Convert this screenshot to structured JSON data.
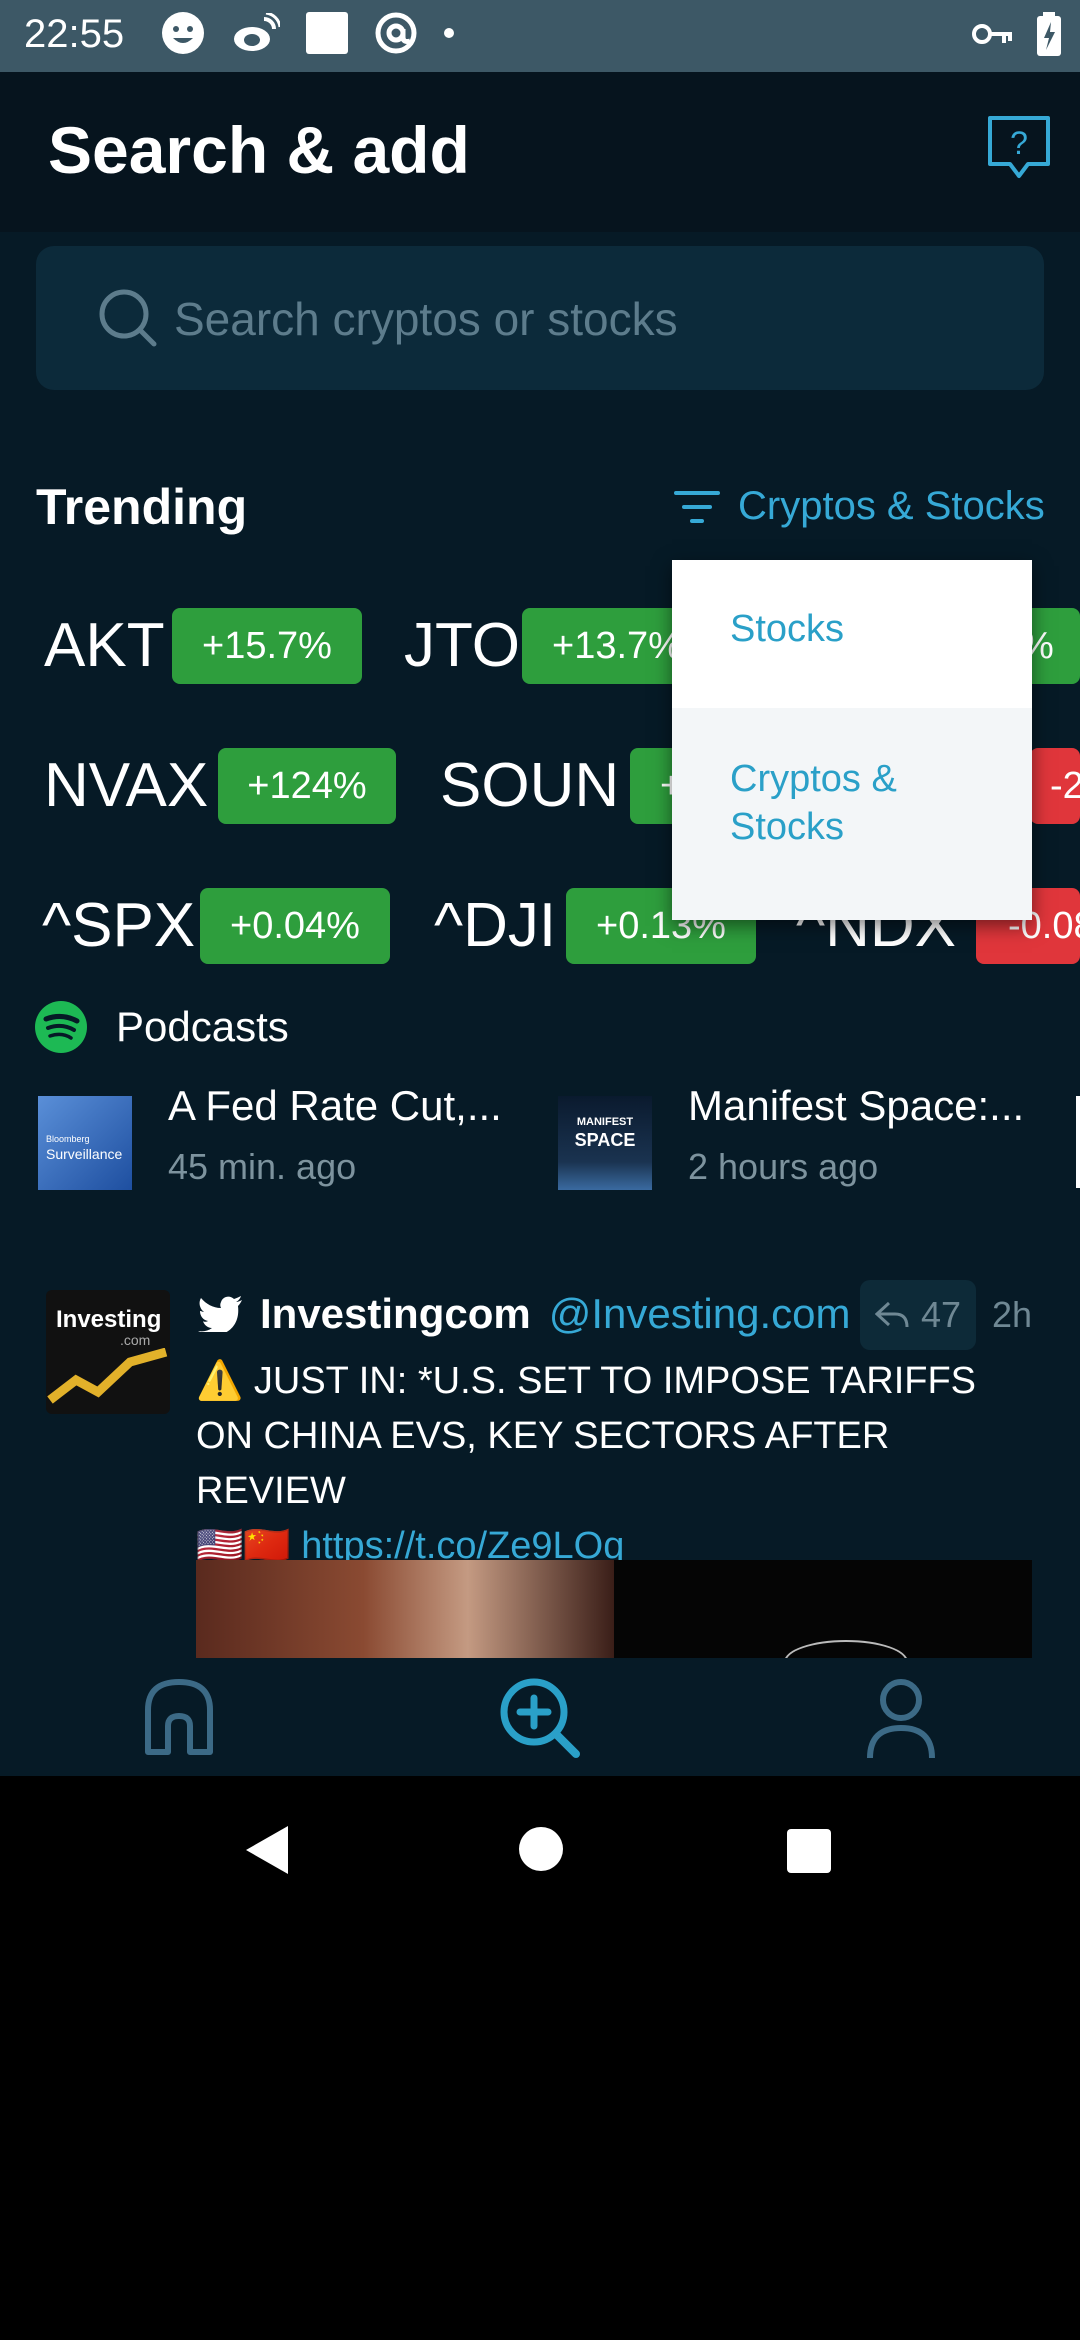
{
  "status_bar": {
    "time": "22:55",
    "icons": [
      "face-icon",
      "weibo-icon",
      "square-icon",
      "at-icon",
      "dot-icon"
    ],
    "right_icons": [
      "key-icon",
      "battery-charging-icon"
    ]
  },
  "header": {
    "title": "Search & add",
    "help_icon": "help-chat-icon"
  },
  "search": {
    "placeholder": "Search cryptos or stocks"
  },
  "trending": {
    "title": "Trending",
    "filter_label": "Cryptos & Stocks",
    "rows": [
      [
        {
          "ticker": "AKT",
          "change": "+15.7%",
          "trend": "up"
        },
        {
          "ticker": "JTO",
          "change": "+13.7%",
          "trend": "up"
        },
        {
          "ticker": "",
          "change": "%",
          "trend": "up"
        }
      ],
      [
        {
          "ticker": "NVAX",
          "change": "+124%",
          "trend": "up"
        },
        {
          "ticker": "SOUN",
          "change": "+",
          "trend": "up"
        },
        {
          "ticker": "",
          "change": "-2",
          "trend": "down"
        }
      ],
      [
        {
          "ticker": "^SPX",
          "change": "+0.04%",
          "trend": "up"
        },
        {
          "ticker": "^DJI",
          "change": "+0.13%",
          "trend": "up"
        },
        {
          "ticker": "^NDX",
          "change": "-0.08",
          "trend": "down"
        }
      ]
    ]
  },
  "filter_dropdown": {
    "options": [
      {
        "label": "Stocks"
      },
      {
        "label_line1": "Cryptos &",
        "label_line2": "Stocks"
      }
    ]
  },
  "podcasts": {
    "title": "Podcasts",
    "items": [
      {
        "title": "A Fed Rate Cut,...",
        "time": "45 min. ago",
        "thumb_text": "Surveillance",
        "thumb_small": "Bloomberg"
      },
      {
        "title": "Manifest Space:...",
        "time": "2 hours ago",
        "thumb_line1": "MANIFEST",
        "thumb_line2": "SPACE"
      }
    ]
  },
  "tweet": {
    "avatar_text_1": "Investing",
    "avatar_text_2": ".com",
    "name": "Investingcom",
    "handle": "@Investing.com",
    "reply_count": "47",
    "age": "2h",
    "text": "⚠️ JUST IN:  *U.S. SET TO IMPOSE TARIFFS ON CHINA EVS, KEY SECTORS AFTER REVIEW",
    "flags": "🇺🇸🇨🇳",
    "link": "https://t.co/Ze9LOq"
  },
  "bottom_nav": {
    "items": [
      {
        "name": "home",
        "active": false
      },
      {
        "name": "search-add",
        "active": true
      },
      {
        "name": "profile",
        "active": false
      }
    ]
  },
  "colors": {
    "background": "#061a26",
    "accent": "#36a9d6",
    "positive": "#2e9e3d",
    "negative": "#e0363b"
  }
}
